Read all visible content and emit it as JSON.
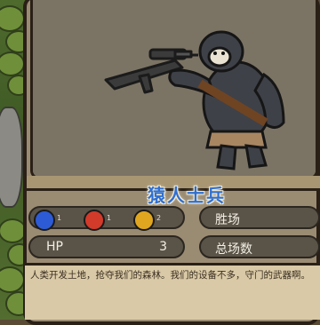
{
  "unit": {
    "name": "猿人士兵",
    "description": "人类开发土地，抢夺我们的森林。我们的设备不多，守门的武器啊。"
  },
  "skills": [
    {
      "icon": "blue-fist-icon",
      "color": "#2d5bd6",
      "level": "1"
    },
    {
      "icon": "red-fist-icon",
      "color": "#d23a2a",
      "level": "1"
    },
    {
      "icon": "gold-claw-icon",
      "color": "#e0a61f",
      "level": "2"
    }
  ],
  "stats": {
    "hp_label": "HP",
    "hp_value": "3",
    "wins_label": "胜场",
    "total_label": "总场数"
  }
}
